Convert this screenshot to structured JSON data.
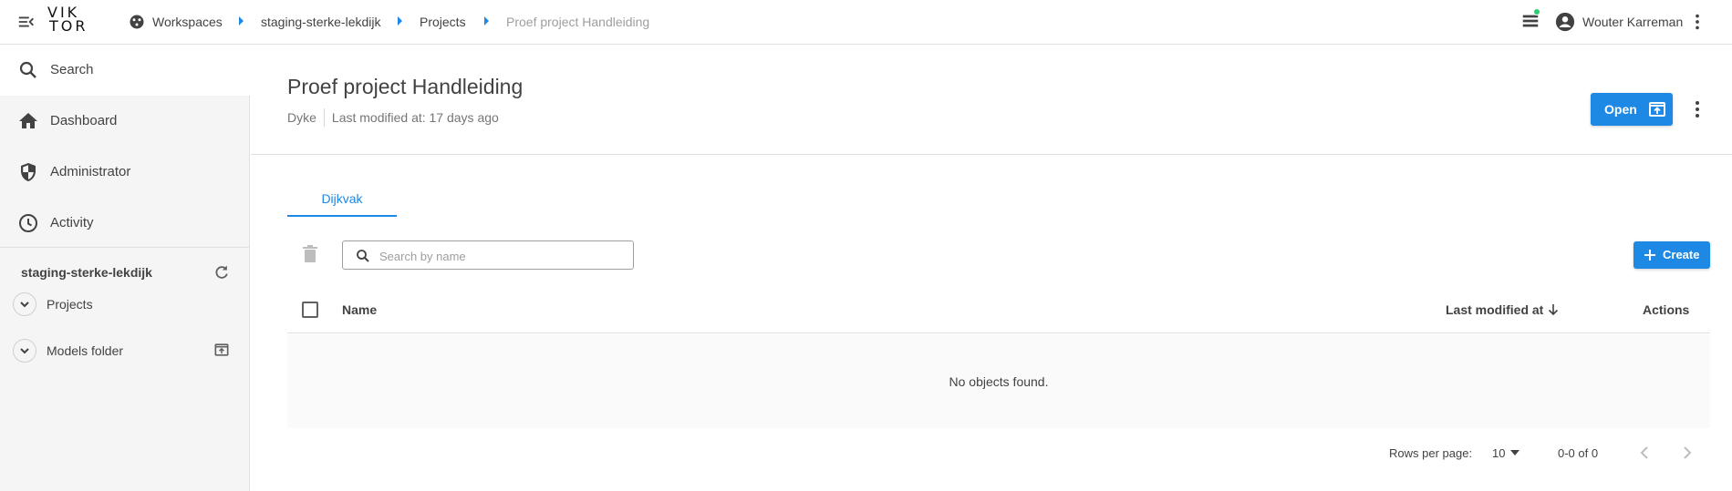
{
  "topbar": {
    "logo": {
      "line1": "VIK",
      "line2": "TOR"
    },
    "breadcrumb": {
      "workspaces": "Workspaces",
      "workspace": "staging-sterke-lekdijk",
      "projects": "Projects",
      "current": "Proef project Handleiding"
    },
    "user_name": "Wouter Karreman",
    "notification_color": "#2ecc71"
  },
  "sidebar": {
    "search_label": "Search",
    "items": [
      {
        "label": "Dashboard",
        "icon": "home-icon"
      },
      {
        "label": "Administrator",
        "icon": "shield-icon"
      },
      {
        "label": "Activity",
        "icon": "clock-icon"
      }
    ],
    "workspace_title": "staging-sterke-lekdijk",
    "tree": [
      {
        "label": "Projects"
      },
      {
        "label": "Models folder"
      }
    ]
  },
  "header": {
    "title": "Proef project Handleiding",
    "entity_type": "Dyke",
    "last_modified": "Last modified at: 17 days ago",
    "open_label": "Open"
  },
  "tabs": [
    {
      "label": "Dijkvak",
      "active": true
    }
  ],
  "toolbar": {
    "search_placeholder": "Search by name",
    "create_label": "Create"
  },
  "table": {
    "columns": {
      "name": "Name",
      "last_modified": "Last modified at",
      "actions": "Actions"
    },
    "empty_message": "No objects found."
  },
  "pagination": {
    "rows_per_page_label": "Rows per page:",
    "rows_per_page_value": "10",
    "range": "0-0 of 0"
  },
  "colors": {
    "accent": "#1e88e5",
    "sidebar_bg": "#f5f5f5"
  }
}
